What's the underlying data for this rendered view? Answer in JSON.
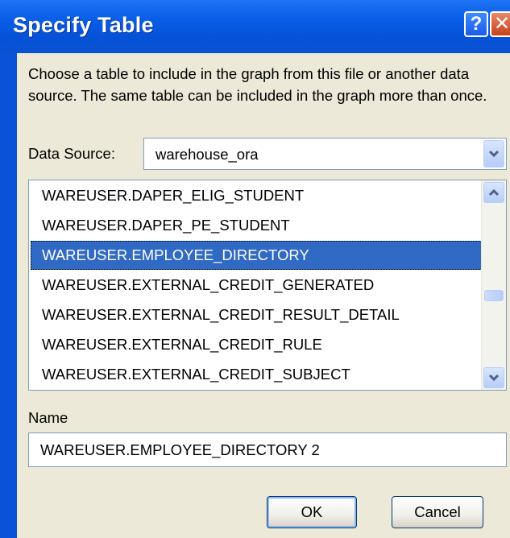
{
  "dialog": {
    "title": "Specify Table",
    "description": "Choose a table to include in the graph from this file or another data source.  The same table can be included in the graph more than once.",
    "help_glyph": "?",
    "close_glyph": "✕"
  },
  "data_source": {
    "label": "Data Source:",
    "value": "warehouse_ora"
  },
  "tables": {
    "items": [
      "WAREUSER.DAPER_ELIG_STUDENT",
      "WAREUSER.DAPER_PE_STUDENT",
      "WAREUSER.EMPLOYEE_DIRECTORY",
      "WAREUSER.EXTERNAL_CREDIT_GENERATED",
      "WAREUSER.EXTERNAL_CREDIT_RESULT_DETAIL",
      "WAREUSER.EXTERNAL_CREDIT_RULE",
      "WAREUSER.EXTERNAL_CREDIT_SUBJECT"
    ],
    "selected": "WAREUSER.EMPLOYEE_DIRECTORY"
  },
  "name_field": {
    "label": "Name",
    "value": "WAREUSER.EMPLOYEE_DIRECTORY 2"
  },
  "buttons": {
    "ok": "OK",
    "cancel": "Cancel"
  },
  "colors": {
    "titlebar": "#0a5ee8",
    "dialog_bg": "#ece9d8",
    "selection": "#316ac5",
    "field_border": "#7f9db9"
  },
  "icons": {
    "help": "help-icon",
    "close": "close-icon",
    "dropdown": "chevron-down-icon",
    "scroll_up": "chevron-up-icon",
    "scroll_down": "chevron-down-icon"
  }
}
